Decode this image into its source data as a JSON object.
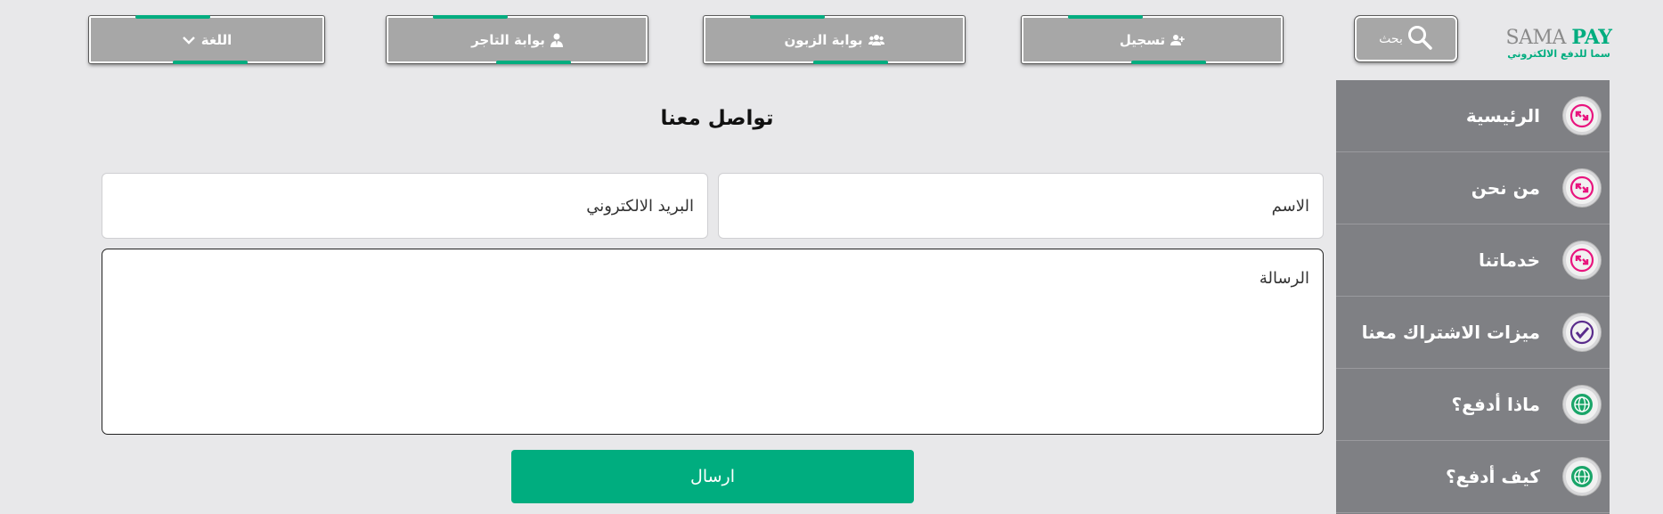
{
  "brand": {
    "logo_latin_1": "SAMA",
    "logo_latin_2": "PAY",
    "logo_arabic": "سما للدفع الالكتروني",
    "colors": {
      "accent": "#00ad7f",
      "sidebar": "#7f8084",
      "button": "#a7a7a7",
      "pink": "#e8157e",
      "purple": "#5a2c8c"
    }
  },
  "header": {
    "search_label": "بحث",
    "register_label": "تسجيل",
    "customer_portal_label": "بوابة الزبون",
    "merchant_portal_label": "بوابة التاجر",
    "language_label": "اللغة"
  },
  "sidebar": {
    "items": [
      {
        "label": "الرئيسية",
        "icon": "arrows-exchange-icon"
      },
      {
        "label": "من نحن",
        "icon": "arrows-exchange-icon"
      },
      {
        "label": "خدماتنا",
        "icon": "arrows-exchange-icon"
      },
      {
        "label": "ميزات الاشتراك معنا",
        "icon": "check-icon"
      },
      {
        "label": "ماذا أدفع؟",
        "icon": "globe-icon"
      },
      {
        "label": "كيف أدفع؟",
        "icon": "globe-icon"
      }
    ]
  },
  "contact_form": {
    "title": "تواصل معنا",
    "name_placeholder": "الاسم",
    "email_placeholder": "البريد الالكتروني",
    "message_placeholder": "الرسالة",
    "submit_label": "ارسال"
  }
}
